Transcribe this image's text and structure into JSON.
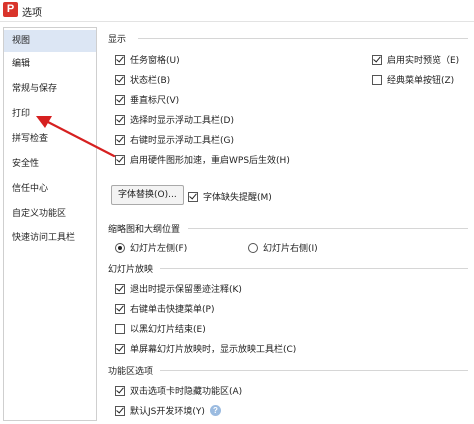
{
  "window": {
    "title": "选项",
    "app_icon": "P"
  },
  "sidebar": {
    "items": [
      {
        "label": "视图",
        "selected": true
      },
      {
        "label": "编辑"
      },
      {
        "label": "常规与保存"
      },
      {
        "label": "打印"
      },
      {
        "label": "拼写检查"
      },
      {
        "label": "安全性"
      },
      {
        "label": "信任中心"
      },
      {
        "label": "自定义功能区"
      },
      {
        "label": "快速访问工具栏"
      }
    ]
  },
  "display": {
    "title": "显示",
    "left": [
      {
        "label": "任务窗格(U)",
        "checked": true
      },
      {
        "label": "状态栏(B)",
        "checked": true
      },
      {
        "label": "垂直标尺(V)",
        "checked": true
      },
      {
        "label": "选择时显示浮动工具栏(D)",
        "checked": true
      },
      {
        "label": "右键时显示浮动工具栏(G)",
        "checked": true
      },
      {
        "label": "启用硬件图形加速，重启WPS后生效(H)",
        "checked": true
      }
    ],
    "right": [
      {
        "label": "启用实时预览（E)",
        "checked": true
      },
      {
        "label": "经典菜单按钮(Z)",
        "checked": false
      }
    ],
    "font_replace_button": "字体替换(O)...",
    "font_missing_hint": {
      "label": "字体缺失提醒(M)",
      "checked": true
    }
  },
  "thumbnail": {
    "title": "缩略图和大纲位置",
    "left_radio": {
      "label": "幻灯片左侧(F)",
      "checked": true
    },
    "right_radio": {
      "label": "幻灯片右侧(I)",
      "checked": false
    }
  },
  "slideshow": {
    "title": "幻灯片放映",
    "items": [
      {
        "label": "退出时提示保留墨迹注释(K)",
        "checked": true
      },
      {
        "label": "右键单击快捷菜单(P)",
        "checked": true
      },
      {
        "label": "以黑幻灯片结束(E)",
        "checked": false
      },
      {
        "label": "单屏幕幻灯片放映时，显示放映工具栏(C)",
        "checked": true
      }
    ]
  },
  "ribbon": {
    "title": "功能区选项",
    "items": [
      {
        "label": "双击选项卡时隐藏功能区(A)",
        "checked": true
      },
      {
        "label": "默认JS开发环境(Y)",
        "checked": true
      }
    ]
  },
  "colors": {
    "accent": "#d9342b",
    "selected": "#dce6f4",
    "arrow": "#d62020"
  }
}
